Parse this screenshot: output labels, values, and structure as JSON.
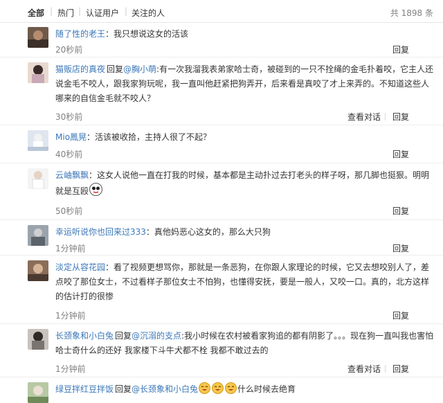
{
  "tabs": [
    "全部",
    "热门",
    "认证用户",
    "关注的人"
  ],
  "total": "共 1898 条",
  "actions": {
    "reply": "回复",
    "view_thread": "查看对话"
  },
  "reply_prefix": "回复",
  "comments": [
    {
      "user": "随了性的老王",
      "text": "：我只想说这女的活该",
      "time": "20秒前"
    },
    {
      "user": "猫贩店的真夜",
      "mention": "@胸小萌",
      "text": ":有一次我溜我表弟家哈士奇，被碰到的一只不拴绳的金毛扑着咬，它主人还说金毛不咬人，跟我家狗玩呢，我一直叫他赶紧把狗弄开，后来看是真咬了才上来弄的。不知道这些人哪来的自信金毛就不咬人？",
      "time": "30秒前"
    },
    {
      "user": "Mio鳳晃",
      "text": "：活该被收拾，主持人很了不起？",
      "time": "40秒前"
    },
    {
      "user": "云岫飘飘",
      "text": "：这女人说他一直在打我的时候，基本都是主动扑过去打老头的样子呀，那几脚也挺狠。明明就是互殴",
      "time": "50秒前"
    },
    {
      "user": "幸运听说你也回来过333",
      "text": "：真他妈恶心这女的，那么大只狗",
      "time": "1分钟前"
    },
    {
      "user": "淡定从容花园",
      "text": "：看了视频更想骂你，那就是一条恶狗，在你跟人家理论的时候，它又去想咬别人了，差点咬了那位女士，不过看样子那位女士不怕狗，也懂得安抚，要是一般人，又咬一口。真的，北方这样的估计打的很惨",
      "time": "1分钟前"
    },
    {
      "user": "长颈象和小白兔",
      "mention": "@沉溺的支点",
      "text": ":我小时候在农村被看家狗追的都有阴影了。。。现在狗一直叫我也害怕 哈士奇什么的还好 我家楼下斗牛犬都不栓 我都不敢过去的",
      "time": "1分钟前"
    },
    {
      "user": "绿豆拌红豆拌饭",
      "mention": "@长颈象和小白兔",
      "text_after": "什么时候去绝育"
    }
  ]
}
